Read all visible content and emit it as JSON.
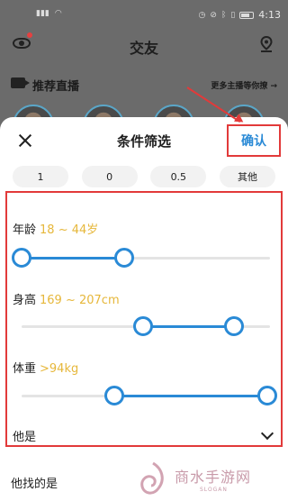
{
  "status_bar": {
    "time": "4:13",
    "battery_icon": "battery-icon"
  },
  "app": {
    "title": "交友"
  },
  "live": {
    "title": "推荐直播",
    "more": "更多主播等你撩 →"
  },
  "sheet": {
    "title": "条件筛选",
    "confirm": "确认",
    "chips": [
      "1",
      "0",
      "0.5",
      "其他"
    ],
    "age": {
      "label": "年龄",
      "value": "18 ~ 44岁",
      "low": 18,
      "high": 44
    },
    "height": {
      "label": "身高",
      "value": "169 ~ 207cm",
      "low": 169,
      "high": 207
    },
    "weight": {
      "label": "体重",
      "value": ">94kg",
      "low": 94
    },
    "tashi": {
      "label": "他是"
    },
    "seeking": {
      "label": "他找的是"
    }
  },
  "watermark": {
    "text": "商水手游网",
    "slogan": "SLOGAN"
  },
  "colors": {
    "accent": "#2a8ad6",
    "value_text": "#e6b73a",
    "annotation": "#e23a3a"
  }
}
